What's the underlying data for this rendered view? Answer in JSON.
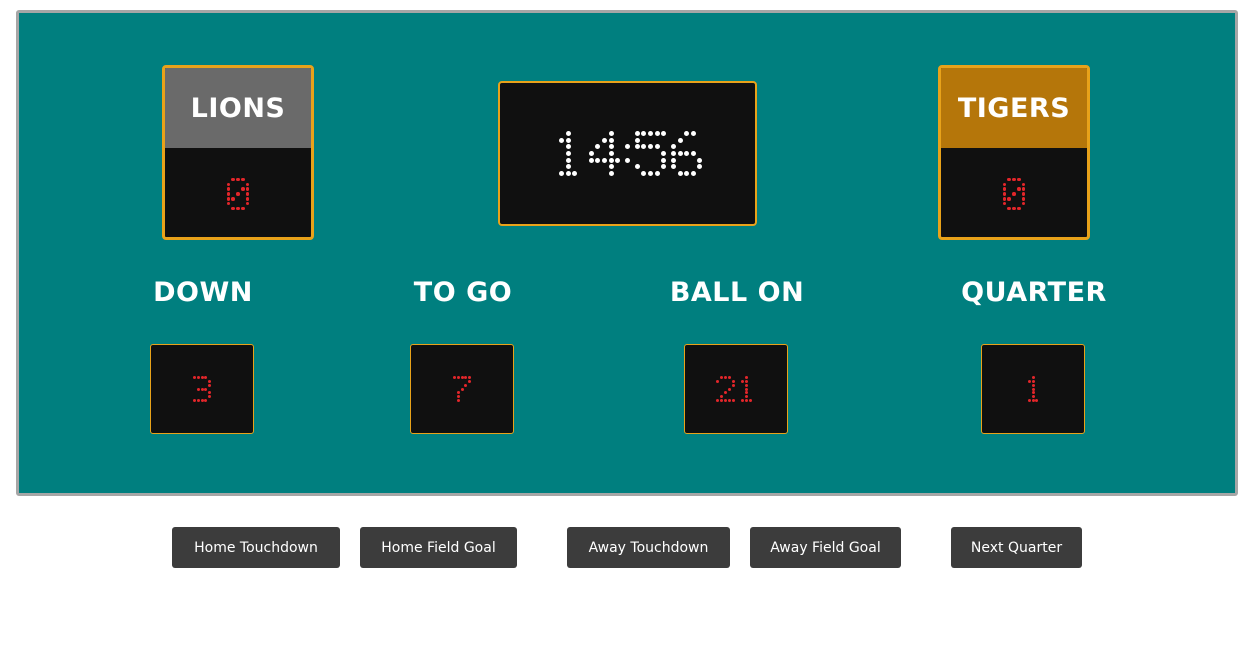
{
  "colors": {
    "board": "#007f7f",
    "board_border": "#a6a6a6",
    "panel": "#101010",
    "accent_border": "#e8a21a",
    "home_header": "#6a6a6a",
    "away_header": "#b5760a",
    "clock_dot": "#ffffff",
    "score_dot": "#e3262a",
    "button": "#3c3c3c"
  },
  "home": {
    "name": "LIONS",
    "score": "0"
  },
  "away": {
    "name": "TIGERS",
    "score": "0"
  },
  "clock": {
    "time": "14:56"
  },
  "stats": [
    {
      "label": "DOWN",
      "value": "3"
    },
    {
      "label": "TO GO",
      "value": "7"
    },
    {
      "label": "BALL ON",
      "value": "21"
    },
    {
      "label": "QUARTER",
      "value": "1"
    }
  ],
  "buttons": {
    "home_touchdown": "Home Touchdown",
    "home_field_goal": "Home Field Goal",
    "away_touchdown": "Away Touchdown",
    "away_field_goal": "Away Field Goal",
    "next_quarter": "Next Quarter"
  }
}
